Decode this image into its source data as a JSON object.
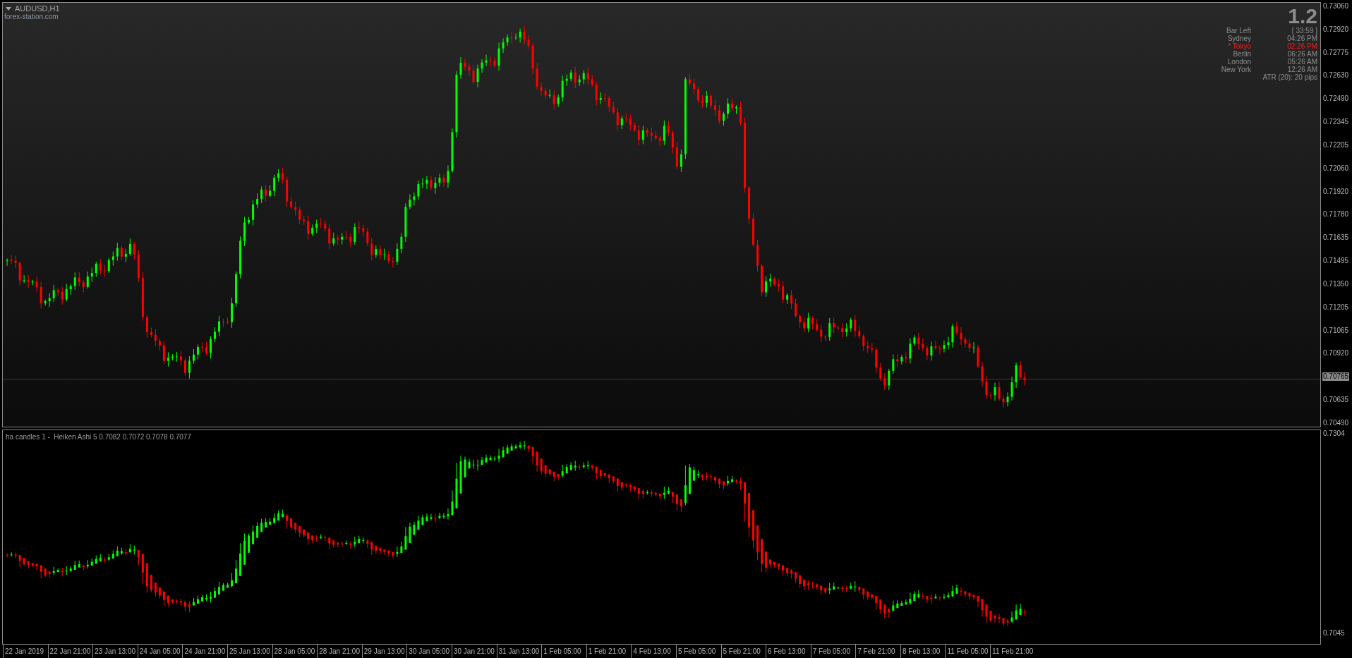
{
  "chart": {
    "symbol": "AUDUSD,H1",
    "source": "forex-station.com"
  },
  "info": {
    "timer": "1.2",
    "rows": [
      {
        "label": "Bar Left",
        "value": "[ 33:59 ]",
        "highlighted": false
      },
      {
        "label": "Sydney",
        "value": "04:26 PM",
        "highlighted": false
      },
      {
        "label": "* Tokyo",
        "value": "02:26 PM",
        "highlighted": true
      },
      {
        "label": "Berlin",
        "value": "06:26 AM",
        "highlighted": false
      },
      {
        "label": "London",
        "value": "05:26 AM",
        "highlighted": false
      },
      {
        "label": "New York",
        "value": "12:26 AM",
        "highlighted": false
      }
    ],
    "atr": "ATR (20): 20 pips"
  },
  "price_axis": [
    {
      "label": "0.73060",
      "current": false
    },
    {
      "label": "0.72920",
      "current": false
    },
    {
      "label": "0.72775",
      "current": false
    },
    {
      "label": "0.72630",
      "current": false
    },
    {
      "label": "0.72490",
      "current": false
    },
    {
      "label": "0.72345",
      "current": false
    },
    {
      "label": "0.72205",
      "current": false
    },
    {
      "label": "0.72060",
      "current": false
    },
    {
      "label": "0.71920",
      "current": false
    },
    {
      "label": "0.71780",
      "current": false
    },
    {
      "label": "0.71635",
      "current": false
    },
    {
      "label": "0.71495",
      "current": false
    },
    {
      "label": "0.71350",
      "current": false
    },
    {
      "label": "0.71205",
      "current": false
    },
    {
      "label": "0.71065",
      "current": false
    },
    {
      "label": "0.70920",
      "current": false
    },
    {
      "label": "0.70765",
      "current": true
    },
    {
      "label": "0.70635",
      "current": false
    },
    {
      "label": "0.70490",
      "current": false
    }
  ],
  "indicator": {
    "label": "ha candles 1 -  Heiken Ashi 5 0.7082 0.7072 0.7078 0.7077",
    "axis": [
      "0.7304",
      "0.7045"
    ]
  },
  "time_axis": [
    "22 Jan 2019",
    "22 Jan 21:00",
    "23 Jan 13:00",
    "24 Jan 05:00",
    "24 Jan 21:00",
    "25 Jan 13:00",
    "28 Jan 05:00",
    "28 Jan 21:00",
    "29 Jan 13:00",
    "30 Jan 05:00",
    "30 Jan 21:00",
    "31 Jan 13:00",
    "1 Feb 05:00",
    "1 Feb 21:00",
    "4 Feb 13:00",
    "5 Feb 05:00",
    "5 Feb 21:00",
    "6 Feb 13:00",
    "7 Feb 05:00",
    "7 Feb 21:00",
    "8 Feb 13:00",
    "11 Feb 05:00",
    "11 Feb 21:00"
  ]
}
